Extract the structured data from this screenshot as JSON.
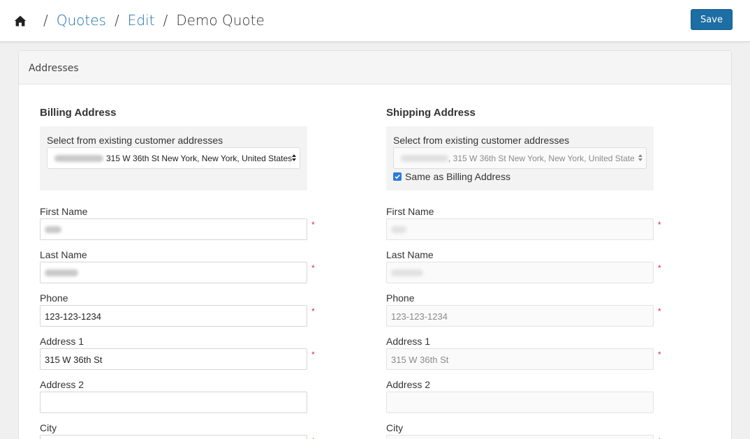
{
  "breadcrumb": {
    "quotes": "Quotes",
    "edit": "Edit",
    "current": "Demo Quote",
    "sep": "/"
  },
  "toolbar": {
    "save_label": "Save"
  },
  "panel": {
    "title": "Addresses"
  },
  "billing": {
    "title": "Billing Address",
    "select_label": "Select from existing customer addresses",
    "select_value": "315 W 36th St New York, New York, United States",
    "fields": {
      "first_name_label": "First Name",
      "last_name_label": "Last Name",
      "phone_label": "Phone",
      "phone_value": "123-123-1234",
      "address1_label": "Address 1",
      "address1_value": "315 W 36th St",
      "address2_label": "Address 2",
      "city_label": "City"
    }
  },
  "shipping": {
    "title": "Shipping Address",
    "select_label": "Select from existing customer addresses",
    "select_value": ", 315 W 36th St New York, New York, United States",
    "same_as_billing_label": "Same as Billing Address",
    "same_as_billing_checked": true,
    "fields": {
      "first_name_label": "First Name",
      "last_name_label": "Last Name",
      "phone_label": "Phone",
      "phone_value": "123-123-1234",
      "address1_label": "Address 1",
      "address1_value": "315 W 36th St",
      "address2_label": "Address 2",
      "city_label": "City"
    }
  },
  "required_marker": "*",
  "colors": {
    "link": "#1b6fa3",
    "primary_button": "#1c6ea4",
    "required": "#e0302a",
    "checkbox": "#2a7ad9"
  }
}
